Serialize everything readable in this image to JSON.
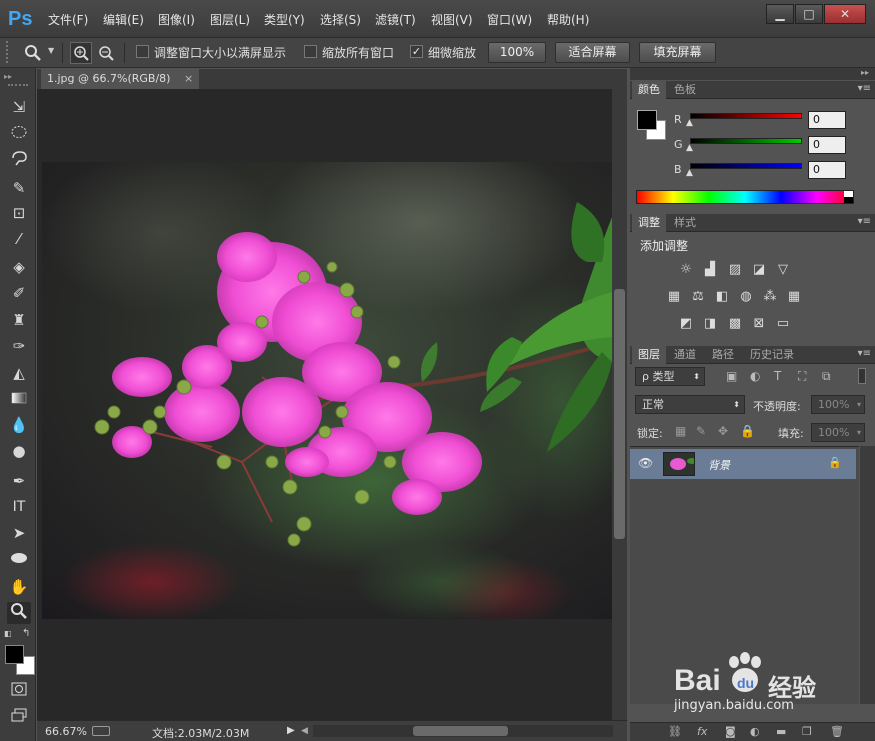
{
  "app": {
    "logo": "Ps"
  },
  "menu": [
    "文件(F)",
    "编辑(E)",
    "图像(I)",
    "图层(L)",
    "类型(Y)",
    "选择(S)",
    "滤镜(T)",
    "视图(V)",
    "窗口(W)",
    "帮助(H)"
  ],
  "window_controls": {
    "minimize": "▁",
    "maximize": "□",
    "close": "✕"
  },
  "options": {
    "zoom_in_icon": "zoom-in-icon",
    "zoom_out_icon": "zoom-out-icon",
    "resize_windows_label": "调整窗口大小以满屏显示",
    "resize_windows_checked": false,
    "zoom_all_label": "缩放所有窗口",
    "zoom_all_checked": false,
    "scrubby_label": "细微缩放",
    "scrubby_checked": true,
    "btn_100": "100%",
    "btn_fit": "适合屏幕",
    "btn_fill": "填充屏幕"
  },
  "document": {
    "tab_title": "1.jpg @ 66.7%(RGB/8)",
    "tab_close": "×"
  },
  "status": {
    "zoom": "66.67%",
    "doc_info": "文档:2.03M/2.03M"
  },
  "color_panel": {
    "tabs": [
      "颜色",
      "色板"
    ],
    "r_label": "R",
    "g_label": "G",
    "b_label": "B",
    "r_value": "0",
    "g_value": "0",
    "b_value": "0",
    "foreground": "#000000",
    "background": "#ffffff"
  },
  "adjust_panel": {
    "tabs": [
      "调整",
      "样式"
    ],
    "title": "添加调整"
  },
  "layers_panel": {
    "tabs": [
      "图层",
      "通道",
      "路径",
      "历史记录"
    ],
    "filter_label": "ρ 类型",
    "blend_mode": "正常",
    "opacity_label": "不透明度:",
    "opacity_value": "100%",
    "lock_label": "锁定:",
    "fill_label": "填充:",
    "fill_value": "100%",
    "layer_name": "背景"
  },
  "watermark": {
    "brand": "Bai",
    "paw": "du",
    "site_cn": "经验",
    "url": "jingyan.baidu.com"
  }
}
